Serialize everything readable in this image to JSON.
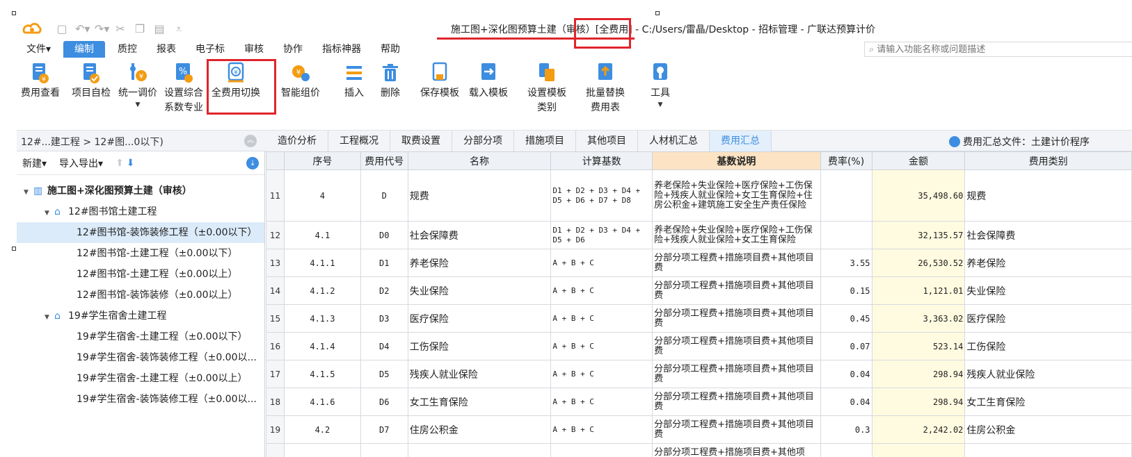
{
  "window": {
    "title": "施工图+深化图预算土建（审核）[全费用] - C:/Users/雷晶/Desktop - 招标管理 - 广联达预算计价"
  },
  "quick_access": [
    "save-icon",
    "undo-icon",
    "redo-icon",
    "cut-icon",
    "copy-icon",
    "paste-icon",
    "customize-icon"
  ],
  "menu": {
    "items": [
      "文件▾",
      "编制",
      "质控",
      "报表",
      "电子标",
      "审核",
      "协作",
      "指标神器",
      "帮助"
    ],
    "active": "编制",
    "search_placeholder": "请输入功能名称或问题描述"
  },
  "ribbon": {
    "buttons": [
      {
        "label": "费用查看",
        "icon": "fee-view-icon"
      },
      {
        "label": "项目自检",
        "icon": "self-check-icon"
      },
      {
        "label": "统一调价",
        "icon": "price-adjust-icon",
        "dropdown": true
      },
      {
        "label": "设置综合\n系数专业",
        "icon": "coefficient-icon"
      },
      {
        "label": "全费用切换",
        "icon": "full-fee-switch-icon",
        "highlighted": true
      },
      {
        "label": "智能组价",
        "icon": "smart-pricing-icon"
      },
      {
        "label": "插入",
        "icon": "insert-icon"
      },
      {
        "label": "删除",
        "icon": "delete-icon"
      },
      {
        "label": "保存模板",
        "icon": "save-template-icon"
      },
      {
        "label": "载入模板",
        "icon": "load-template-icon"
      },
      {
        "label": "设置模板\n类别",
        "icon": "template-category-icon"
      },
      {
        "label": "批量替换\n费用表",
        "icon": "batch-replace-icon"
      },
      {
        "label": "工具",
        "icon": "tools-icon",
        "dropdown": true
      }
    ]
  },
  "breadcrumb": "12#...建工程 > 12#图...0以下)",
  "tabs": [
    "造价分析",
    "工程概况",
    "取费设置",
    "分部分项",
    "措施项目",
    "其他项目",
    "人材机汇总",
    "费用汇总"
  ],
  "active_tab": "费用汇总",
  "summary_file": "费用汇总文件：土建计价程序",
  "left_toolbar": {
    "new": "新建▾",
    "import_export": "导入导出▾"
  },
  "tree": [
    {
      "label": "施工图+深化图预算土建（审核）",
      "level": 0,
      "type": "project",
      "expanded": true
    },
    {
      "label": "12#图书馆土建工程",
      "level": 1,
      "type": "group",
      "expanded": true
    },
    {
      "label": "12#图书馆-装饰装修工程（±0.00以下）",
      "level": 2,
      "type": "unit",
      "selected": true
    },
    {
      "label": "12#图书馆-土建工程（±0.00以下）",
      "level": 2,
      "type": "unit"
    },
    {
      "label": "12#图书馆-土建工程（±0.00以上）",
      "level": 2,
      "type": "unit"
    },
    {
      "label": "12#图书馆-装饰装修（±0.00以上）",
      "level": 2,
      "type": "unit"
    },
    {
      "label": "19#学生宿舍土建工程",
      "level": 1,
      "type": "group",
      "expanded": true
    },
    {
      "label": "19#学生宿舍-土建工程（±0.00以下）",
      "level": 2,
      "type": "unit"
    },
    {
      "label": "19#学生宿舍-装饰装修工程（±0.00以...",
      "level": 2,
      "type": "unit"
    },
    {
      "label": "19#学生宿舍-土建工程（±0.00以上）",
      "level": 2,
      "type": "unit"
    },
    {
      "label": "19#学生宿舍-装饰装修工程（±0.00以...",
      "level": 2,
      "type": "unit"
    }
  ],
  "grid": {
    "columns": [
      "",
      "序号",
      "费用代号",
      "名称",
      "计算基数",
      "基数说明",
      "费率(%)",
      "金额",
      "费用类别"
    ],
    "rows": [
      {
        "rn": "11",
        "seq": "4",
        "code": "D",
        "name": "规费",
        "base": "D1 + D2 + D3 + D4 + D5 + D6 + D7 + D8",
        "desc": "养老保险+失业保险+医疗保险+工伤保险+残疾人就业保险+女工生育保险+住房公积金+建筑施工安全生产责任保险",
        "rate": "",
        "amount": "35,498.60",
        "cat": "规费"
      },
      {
        "rn": "12",
        "seq": "4.1",
        "code": "D0",
        "name": "社会保障费",
        "base": "D1 + D2 + D3 + D4 + D5 + D6",
        "desc": "养老保险+失业保险+医疗保险+工伤保险+残疾人就业保险+女工生育保险",
        "rate": "",
        "amount": "32,135.57",
        "cat": "社会保障费"
      },
      {
        "rn": "13",
        "seq": "4.1.1",
        "code": "D1",
        "name": "养老保险",
        "base": "A + B + C",
        "desc": "分部分项工程费+措施项目费+其他项目费",
        "rate": "3.55",
        "amount": "26,530.52",
        "cat": "养老保险"
      },
      {
        "rn": "14",
        "seq": "4.1.2",
        "code": "D2",
        "name": "失业保险",
        "base": "A + B + C",
        "desc": "分部分项工程费+措施项目费+其他项目费",
        "rate": "0.15",
        "amount": "1,121.01",
        "cat": "失业保险"
      },
      {
        "rn": "15",
        "seq": "4.1.3",
        "code": "D3",
        "name": "医疗保险",
        "base": "A + B + C",
        "desc": "分部分项工程费+措施项目费+其他项目费",
        "rate": "0.45",
        "amount": "3,363.02",
        "cat": "医疗保险"
      },
      {
        "rn": "16",
        "seq": "4.1.4",
        "code": "D4",
        "name": "工伤保险",
        "base": "A + B + C",
        "desc": "分部分项工程费+措施项目费+其他项目费",
        "rate": "0.07",
        "amount": "523.14",
        "cat": "工伤保险"
      },
      {
        "rn": "17",
        "seq": "4.1.5",
        "code": "D5",
        "name": "残疾人就业保险",
        "base": "A + B + C",
        "desc": "分部分项工程费+措施项目费+其他项目费",
        "rate": "0.04",
        "amount": "298.94",
        "cat": "残疾人就业保险"
      },
      {
        "rn": "18",
        "seq": "4.1.6",
        "code": "D6",
        "name": "女工生育保险",
        "base": "A + B + C",
        "desc": "分部分项工程费+措施项目费+其他项目费",
        "rate": "0.04",
        "amount": "298.94",
        "cat": "女工生育保险"
      },
      {
        "rn": "19",
        "seq": "4.2",
        "code": "D7",
        "name": "住房公积金",
        "base": "A + B + C",
        "desc": "分部分项工程费+措施项目费+其他项目费",
        "rate": "0.3",
        "amount": "2,242.02",
        "cat": "住房公积金"
      },
      {
        "rn": "",
        "seq": "",
        "code": "",
        "name": "",
        "base": "",
        "desc": "分部分项工程费+措施项目费+其他项",
        "rate": "",
        "amount": "",
        "cat": ""
      }
    ]
  },
  "colors": {
    "accent": "#3d8de0",
    "annotation": "#e0242b",
    "amount_bg": "#fffbe0",
    "header_highlight": "#fbe3c3"
  }
}
